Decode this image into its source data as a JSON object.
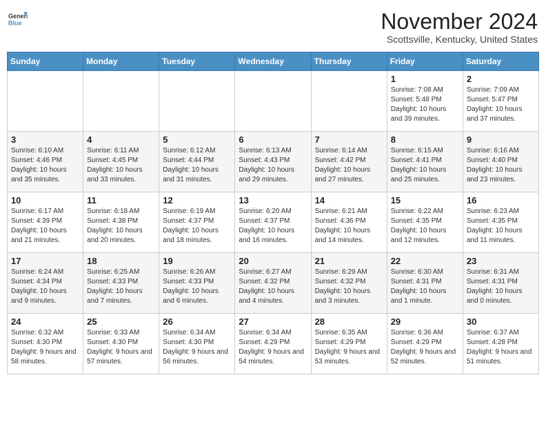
{
  "header": {
    "logo_general": "General",
    "logo_blue": "Blue",
    "month": "November 2024",
    "location": "Scottsville, Kentucky, United States"
  },
  "weekdays": [
    "Sunday",
    "Monday",
    "Tuesday",
    "Wednesday",
    "Thursday",
    "Friday",
    "Saturday"
  ],
  "weeks": [
    [
      {
        "day": "",
        "info": ""
      },
      {
        "day": "",
        "info": ""
      },
      {
        "day": "",
        "info": ""
      },
      {
        "day": "",
        "info": ""
      },
      {
        "day": "",
        "info": ""
      },
      {
        "day": "1",
        "info": "Sunrise: 7:08 AM\nSunset: 5:48 PM\nDaylight: 10 hours and 39 minutes."
      },
      {
        "day": "2",
        "info": "Sunrise: 7:09 AM\nSunset: 5:47 PM\nDaylight: 10 hours and 37 minutes."
      }
    ],
    [
      {
        "day": "3",
        "info": "Sunrise: 6:10 AM\nSunset: 4:46 PM\nDaylight: 10 hours and 35 minutes."
      },
      {
        "day": "4",
        "info": "Sunrise: 6:11 AM\nSunset: 4:45 PM\nDaylight: 10 hours and 33 minutes."
      },
      {
        "day": "5",
        "info": "Sunrise: 6:12 AM\nSunset: 4:44 PM\nDaylight: 10 hours and 31 minutes."
      },
      {
        "day": "6",
        "info": "Sunrise: 6:13 AM\nSunset: 4:43 PM\nDaylight: 10 hours and 29 minutes."
      },
      {
        "day": "7",
        "info": "Sunrise: 6:14 AM\nSunset: 4:42 PM\nDaylight: 10 hours and 27 minutes."
      },
      {
        "day": "8",
        "info": "Sunrise: 6:15 AM\nSunset: 4:41 PM\nDaylight: 10 hours and 25 minutes."
      },
      {
        "day": "9",
        "info": "Sunrise: 6:16 AM\nSunset: 4:40 PM\nDaylight: 10 hours and 23 minutes."
      }
    ],
    [
      {
        "day": "10",
        "info": "Sunrise: 6:17 AM\nSunset: 4:39 PM\nDaylight: 10 hours and 21 minutes."
      },
      {
        "day": "11",
        "info": "Sunrise: 6:18 AM\nSunset: 4:38 PM\nDaylight: 10 hours and 20 minutes."
      },
      {
        "day": "12",
        "info": "Sunrise: 6:19 AM\nSunset: 4:37 PM\nDaylight: 10 hours and 18 minutes."
      },
      {
        "day": "13",
        "info": "Sunrise: 6:20 AM\nSunset: 4:37 PM\nDaylight: 10 hours and 16 minutes."
      },
      {
        "day": "14",
        "info": "Sunrise: 6:21 AM\nSunset: 4:36 PM\nDaylight: 10 hours and 14 minutes."
      },
      {
        "day": "15",
        "info": "Sunrise: 6:22 AM\nSunset: 4:35 PM\nDaylight: 10 hours and 12 minutes."
      },
      {
        "day": "16",
        "info": "Sunrise: 6:23 AM\nSunset: 4:35 PM\nDaylight: 10 hours and 11 minutes."
      }
    ],
    [
      {
        "day": "17",
        "info": "Sunrise: 6:24 AM\nSunset: 4:34 PM\nDaylight: 10 hours and 9 minutes."
      },
      {
        "day": "18",
        "info": "Sunrise: 6:25 AM\nSunset: 4:33 PM\nDaylight: 10 hours and 7 minutes."
      },
      {
        "day": "19",
        "info": "Sunrise: 6:26 AM\nSunset: 4:33 PM\nDaylight: 10 hours and 6 minutes."
      },
      {
        "day": "20",
        "info": "Sunrise: 6:27 AM\nSunset: 4:32 PM\nDaylight: 10 hours and 4 minutes."
      },
      {
        "day": "21",
        "info": "Sunrise: 6:29 AM\nSunset: 4:32 PM\nDaylight: 10 hours and 3 minutes."
      },
      {
        "day": "22",
        "info": "Sunrise: 6:30 AM\nSunset: 4:31 PM\nDaylight: 10 hours and 1 minute."
      },
      {
        "day": "23",
        "info": "Sunrise: 6:31 AM\nSunset: 4:31 PM\nDaylight: 10 hours and 0 minutes."
      }
    ],
    [
      {
        "day": "24",
        "info": "Sunrise: 6:32 AM\nSunset: 4:30 PM\nDaylight: 9 hours and 58 minutes."
      },
      {
        "day": "25",
        "info": "Sunrise: 6:33 AM\nSunset: 4:30 PM\nDaylight: 9 hours and 57 minutes."
      },
      {
        "day": "26",
        "info": "Sunrise: 6:34 AM\nSunset: 4:30 PM\nDaylight: 9 hours and 56 minutes."
      },
      {
        "day": "27",
        "info": "Sunrise: 6:34 AM\nSunset: 4:29 PM\nDaylight: 9 hours and 54 minutes."
      },
      {
        "day": "28",
        "info": "Sunrise: 6:35 AM\nSunset: 4:29 PM\nDaylight: 9 hours and 53 minutes."
      },
      {
        "day": "29",
        "info": "Sunrise: 6:36 AM\nSunset: 4:29 PM\nDaylight: 9 hours and 52 minutes."
      },
      {
        "day": "30",
        "info": "Sunrise: 6:37 AM\nSunset: 4:28 PM\nDaylight: 9 hours and 51 minutes."
      }
    ]
  ],
  "colors": {
    "header_bg": "#4a90c4",
    "accent": "#4a90c4"
  }
}
